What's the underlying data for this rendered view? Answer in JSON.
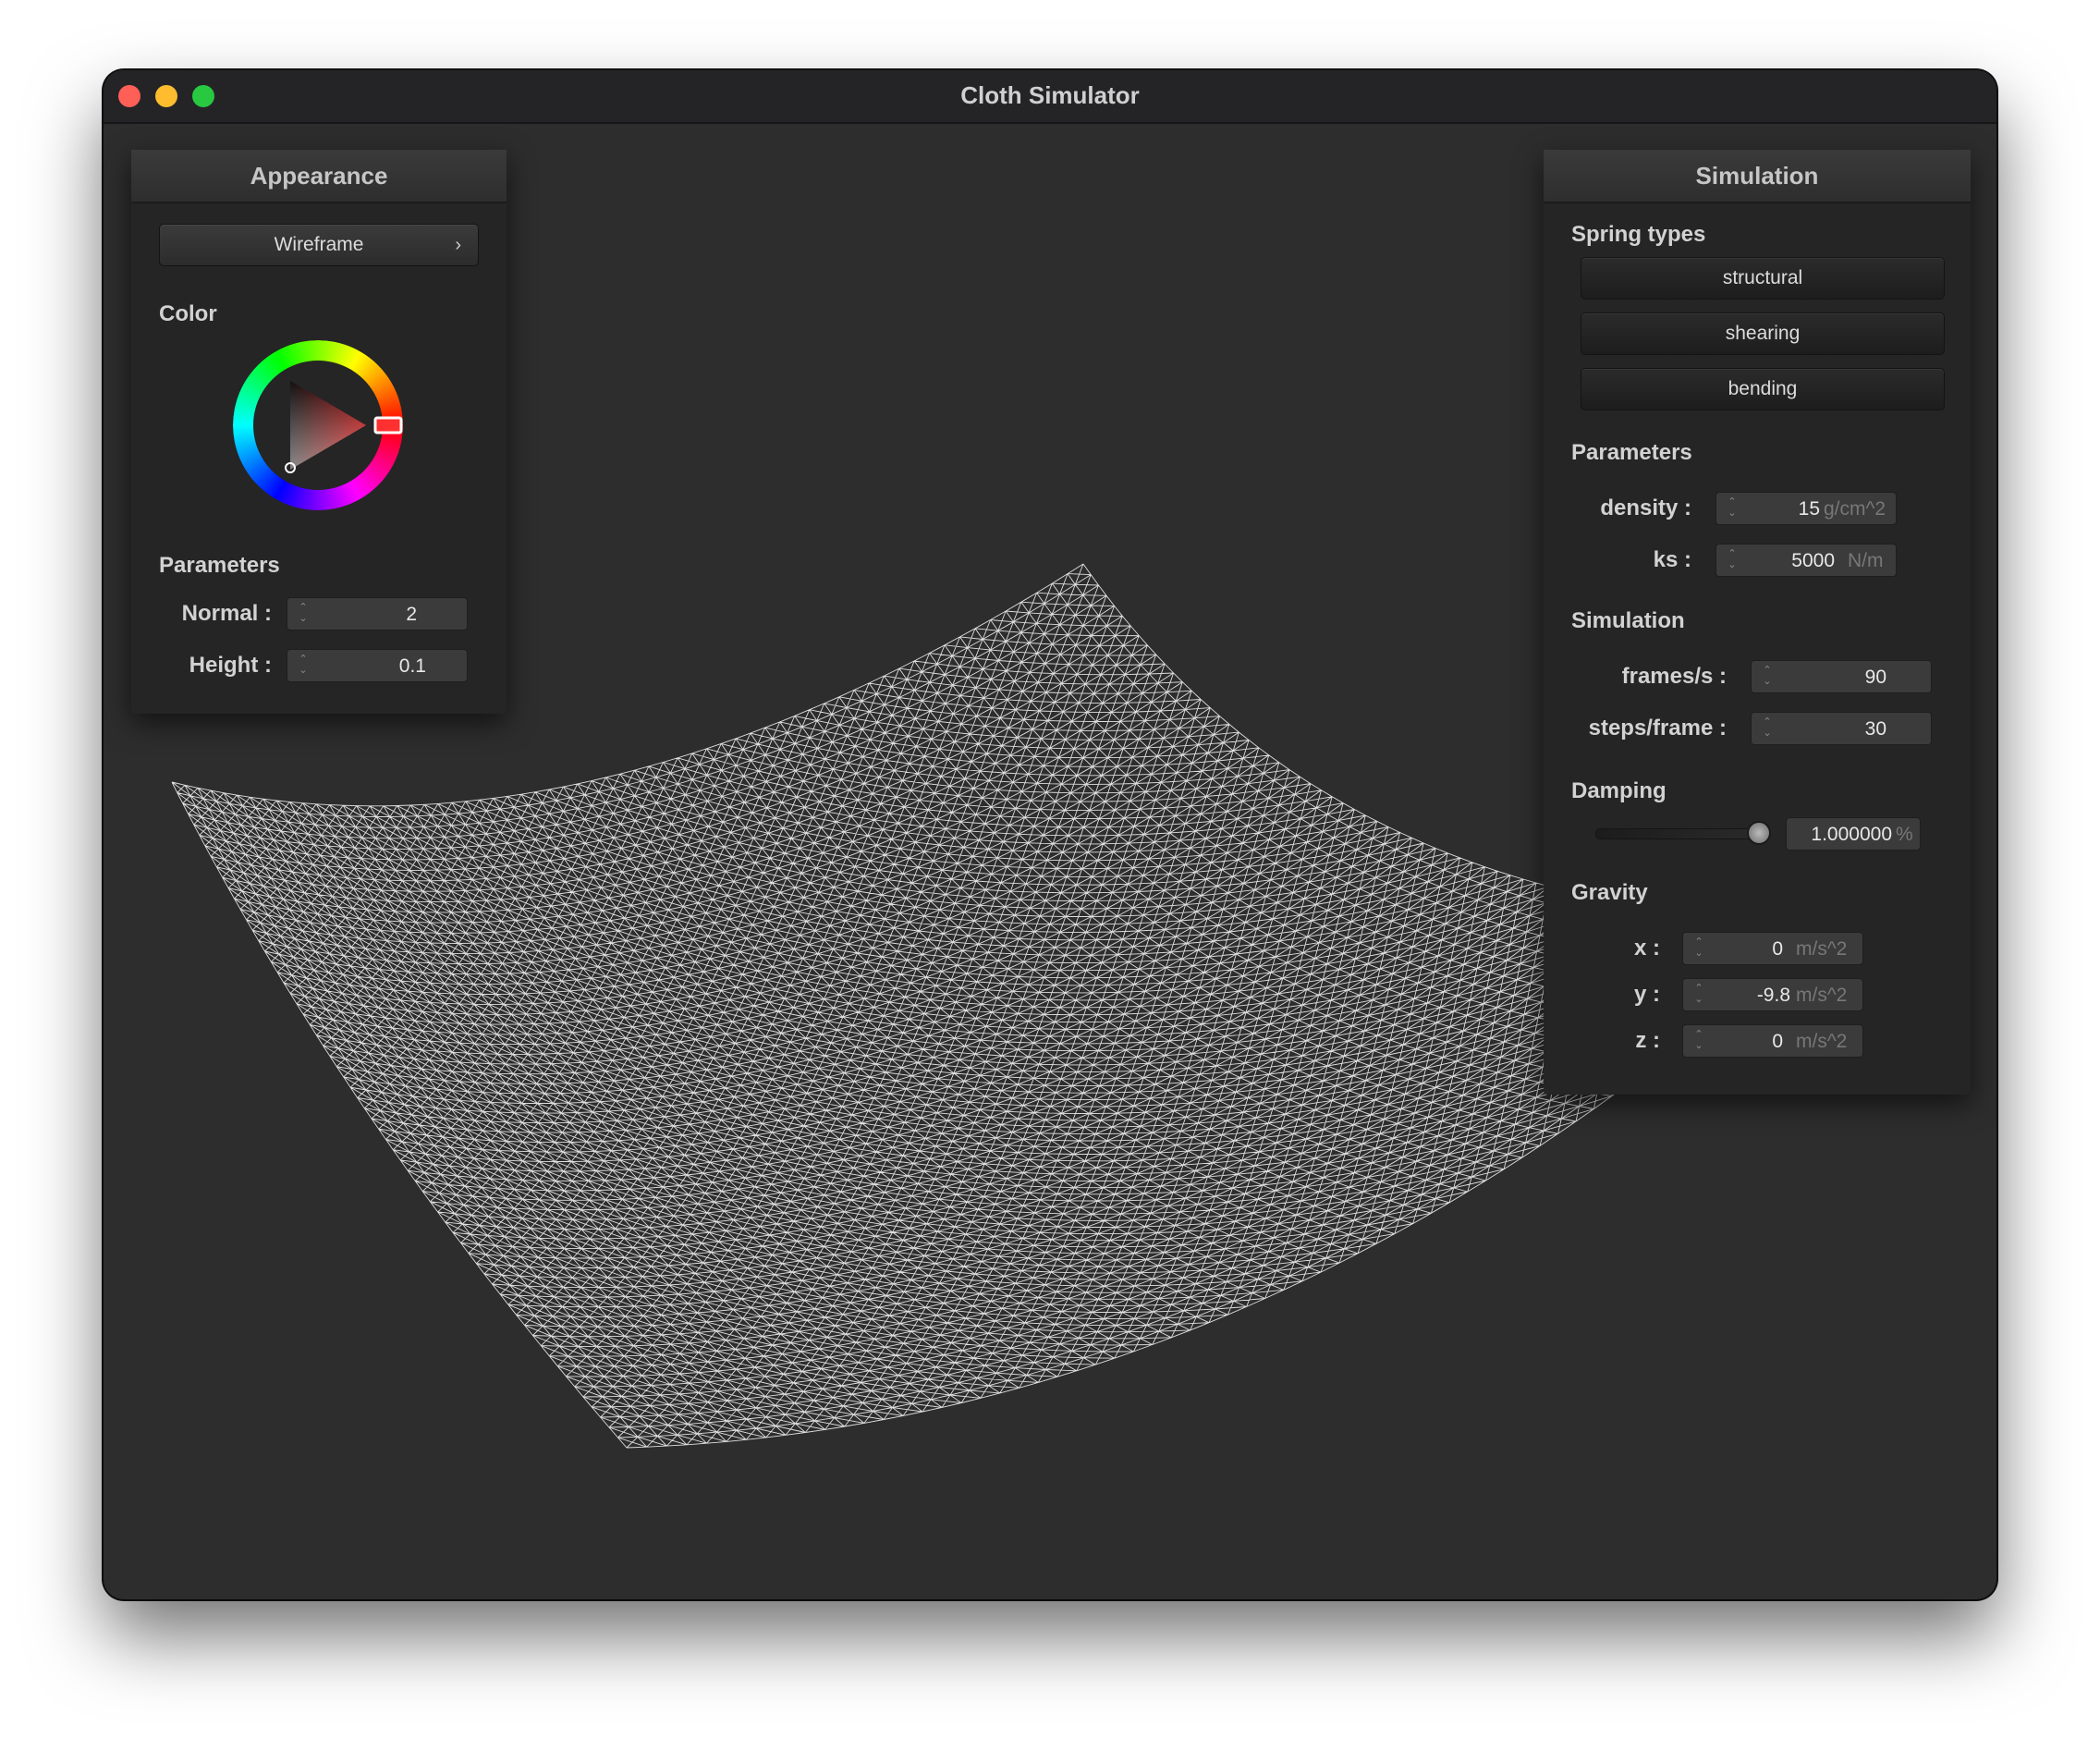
{
  "window": {
    "title": "Cloth Simulator"
  },
  "appearance": {
    "header": "Appearance",
    "shader_selector": "Wireframe",
    "color_label": "Color",
    "selected_color": "#ff0000",
    "parameters_label": "Parameters",
    "normal_label": "Normal :",
    "normal_value": "2",
    "height_label": "Height :",
    "height_value": "0.1"
  },
  "simulation": {
    "header": "Simulation",
    "spring_types_label": "Spring types",
    "spring_buttons": [
      "structural",
      "shearing",
      "bending"
    ],
    "parameters_label": "Parameters",
    "density_label": "density :",
    "density_value": "15",
    "density_unit": "g/cm^2",
    "ks_label": "ks :",
    "ks_value": "5000",
    "ks_unit": "N/m",
    "simulation_label": "Simulation",
    "fps_label": "frames/s :",
    "fps_value": "90",
    "steps_label": "steps/frame :",
    "steps_value": "30",
    "damping_label": "Damping",
    "damping_value": "1.000000",
    "damping_unit": "%",
    "damping_level": 1.0,
    "gravity_label": "Gravity",
    "gx_label": "x :",
    "gx_value": "0",
    "gy_label": "y :",
    "gy_value": "-9.8",
    "gz_label": "z :",
    "gz_value": "0",
    "gravity_unit": "m/s^2"
  },
  "icons": [
    "close-icon",
    "minimize-icon",
    "maximize-icon",
    "chevron-right-icon",
    "spinner-arrows-icon",
    "color-wheel-icon"
  ]
}
